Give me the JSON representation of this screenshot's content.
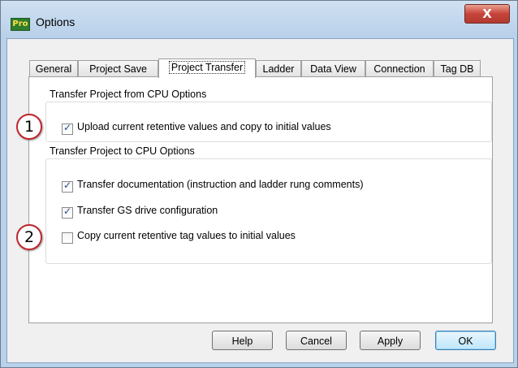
{
  "window": {
    "app_icon_text": "Pro",
    "title": "Options",
    "close_glyph": "X"
  },
  "tabs": [
    {
      "label": "General",
      "active": false
    },
    {
      "label": "Project Save",
      "active": false
    },
    {
      "label": "Project Transfer",
      "active": true
    },
    {
      "label": "Ladder",
      "active": false
    },
    {
      "label": "Data View",
      "active": false
    },
    {
      "label": "Connection",
      "active": false
    },
    {
      "label": "Tag DB",
      "active": false
    }
  ],
  "from_cpu": {
    "label": "Transfer Project from CPU Options",
    "options": [
      {
        "label": "Upload current retentive values and copy to initial values",
        "checked": true
      }
    ]
  },
  "to_cpu": {
    "label": "Transfer Project to CPU Options",
    "options": [
      {
        "label": "Transfer documentation (instruction and ladder rung comments)",
        "checked": true
      },
      {
        "label": "Transfer GS drive configuration",
        "checked": true
      },
      {
        "label": "Copy current retentive tag values to initial values",
        "checked": false
      }
    ]
  },
  "callouts": [
    "1",
    "2"
  ],
  "buttons": {
    "help": "Help",
    "cancel": "Cancel",
    "apply": "Apply",
    "ok": "OK"
  },
  "colors": {
    "callout_border": "#c0262c",
    "close_button": "#c7443a",
    "default_button_border": "#3c7fb1"
  }
}
